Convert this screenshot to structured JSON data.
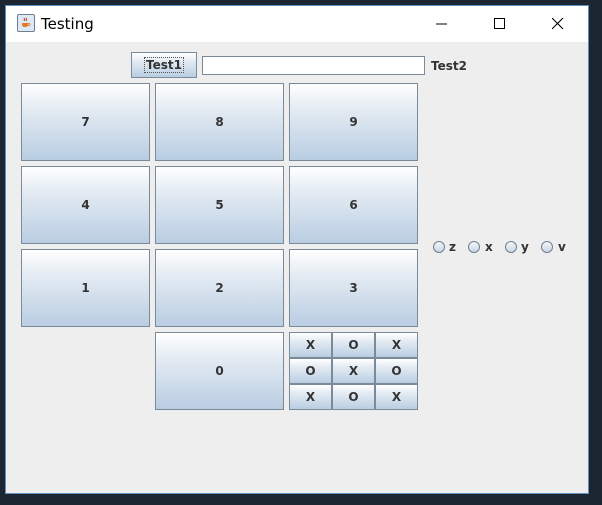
{
  "window": {
    "title": "Testing"
  },
  "titlebar": {
    "app_icon": "java-cup-icon",
    "buttons": [
      "minimize-icon",
      "maximize-icon",
      "close-icon"
    ]
  },
  "toolbar": {
    "button_label": "Test1",
    "text_field_value": "",
    "label": "Test2"
  },
  "keypad": {
    "keys": [
      "7",
      "8",
      "9",
      "4",
      "5",
      "6",
      "1",
      "2",
      "3",
      "0"
    ]
  },
  "tictactoe": {
    "cells": [
      "X",
      "O",
      "X",
      "O",
      "X",
      "O",
      "X",
      "O",
      "X"
    ]
  },
  "radios": [
    {
      "label": "z",
      "selected": false
    },
    {
      "label": "x",
      "selected": false
    },
    {
      "label": "y",
      "selected": false
    },
    {
      "label": "v",
      "selected": false
    }
  ],
  "colors": {
    "button_top": "#ffffff",
    "button_bottom": "#b9cde2",
    "window_border": "#5b8fbf",
    "panel": "#eeeeee"
  }
}
